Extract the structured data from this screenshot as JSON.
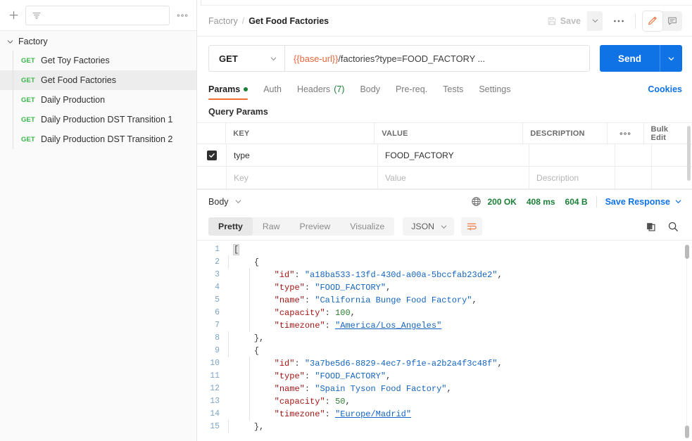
{
  "sidebar": {
    "add_label": "+",
    "filter_placeholder": "",
    "more_label": "000",
    "folder": {
      "name": "Factory",
      "expanded": true
    },
    "requests": [
      {
        "method": "GET",
        "name": "Get Toy Factories",
        "active": false
      },
      {
        "method": "GET",
        "name": "Get Food Factories",
        "active": true
      },
      {
        "method": "GET",
        "name": "Daily Production",
        "active": false
      },
      {
        "method": "GET",
        "name": "Daily Production DST Transition 1",
        "active": false
      },
      {
        "method": "GET",
        "name": "Daily Production DST Transition 2",
        "active": false
      }
    ]
  },
  "header": {
    "breadcrumb_root": "Factory",
    "breadcrumb_sep": "/",
    "breadcrumb_current": "Get Food Factories",
    "save_label": "Save",
    "more_label": "000",
    "edit_icon": "pencil-icon",
    "comment_icon": "comment-icon"
  },
  "request": {
    "method": "GET",
    "url_variable": "{{base-url}}",
    "url_rest": "/factories?type=FOOD_FACTORY ...",
    "send_label": "Send"
  },
  "tabs": {
    "items": [
      {
        "label": "Params",
        "active": true,
        "dot": true
      },
      {
        "label": "Auth",
        "active": false
      },
      {
        "label": "Headers",
        "active": false,
        "count": "(7)"
      },
      {
        "label": "Body",
        "active": false
      },
      {
        "label": "Pre-req.",
        "active": false
      },
      {
        "label": "Tests",
        "active": false
      },
      {
        "label": "Settings",
        "active": false
      }
    ],
    "cookies_label": "Cookies"
  },
  "params": {
    "section_title": "Query Params",
    "columns": [
      "KEY",
      "VALUE",
      "DESCRIPTION"
    ],
    "options_label": "000",
    "bulk_edit_label": "Bulk Edit",
    "rows": [
      {
        "checked": true,
        "key": "type",
        "value": "FOOD_FACTORY",
        "description": ""
      }
    ],
    "placeholder_row": {
      "key": "Key",
      "value": "Value",
      "description": "Description"
    }
  },
  "response": {
    "body_label": "Body",
    "globe_icon": "globe-icon",
    "status": "200 OK",
    "time": "408 ms",
    "size": "604 B",
    "save_response_label": "Save Response",
    "view_tabs": [
      {
        "label": "Pretty",
        "active": true
      },
      {
        "label": "Raw",
        "active": false
      },
      {
        "label": "Preview",
        "active": false
      },
      {
        "label": "Visualize",
        "active": false
      }
    ],
    "format": "JSON",
    "wrap_icon": "word-wrap-icon",
    "copy_icon": "copy-icon",
    "search_icon": "search-icon",
    "code_lines": [
      {
        "n": "1",
        "tokens": [
          {
            "t": "bracket-hl",
            "v": "["
          }
        ]
      },
      {
        "n": "2",
        "tokens": [
          {
            "t": "plain",
            "v": "    "
          },
          {
            "t": "bracket",
            "v": "{"
          }
        ]
      },
      {
        "n": "3",
        "tokens": [
          {
            "t": "plain",
            "v": "        "
          },
          {
            "t": "key",
            "v": "\"id\""
          },
          {
            "t": "punct",
            "v": ": "
          },
          {
            "t": "str",
            "v": "\"a18ba533-13fd-430d-a00a-5bccfab23de2\""
          },
          {
            "t": "punct",
            "v": ","
          }
        ]
      },
      {
        "n": "4",
        "tokens": [
          {
            "t": "plain",
            "v": "        "
          },
          {
            "t": "key",
            "v": "\"type\""
          },
          {
            "t": "punct",
            "v": ": "
          },
          {
            "t": "str",
            "v": "\"FOOD_FACTORY\""
          },
          {
            "t": "punct",
            "v": ","
          }
        ]
      },
      {
        "n": "5",
        "tokens": [
          {
            "t": "plain",
            "v": "        "
          },
          {
            "t": "key",
            "v": "\"name\""
          },
          {
            "t": "punct",
            "v": ": "
          },
          {
            "t": "str",
            "v": "\"California Bunge Food Factory\""
          },
          {
            "t": "punct",
            "v": ","
          }
        ]
      },
      {
        "n": "6",
        "tokens": [
          {
            "t": "plain",
            "v": "        "
          },
          {
            "t": "key",
            "v": "\"capacity\""
          },
          {
            "t": "punct",
            "v": ": "
          },
          {
            "t": "num",
            "v": "100"
          },
          {
            "t": "punct",
            "v": ","
          }
        ]
      },
      {
        "n": "7",
        "tokens": [
          {
            "t": "plain",
            "v": "        "
          },
          {
            "t": "key",
            "v": "\"timezone\""
          },
          {
            "t": "punct",
            "v": ": "
          },
          {
            "t": "str-link",
            "v": "\"America/Los_Angeles\""
          }
        ]
      },
      {
        "n": "8",
        "tokens": [
          {
            "t": "plain",
            "v": "    "
          },
          {
            "t": "bracket",
            "v": "},"
          }
        ]
      },
      {
        "n": "9",
        "tokens": [
          {
            "t": "plain",
            "v": "    "
          },
          {
            "t": "bracket",
            "v": "{"
          }
        ]
      },
      {
        "n": "10",
        "tokens": [
          {
            "t": "plain",
            "v": "        "
          },
          {
            "t": "key",
            "v": "\"id\""
          },
          {
            "t": "punct",
            "v": ": "
          },
          {
            "t": "str",
            "v": "\"3a7be5d6-8829-4ec7-9f1e-a2b2a4f3c48f\""
          },
          {
            "t": "punct",
            "v": ","
          }
        ]
      },
      {
        "n": "11",
        "tokens": [
          {
            "t": "plain",
            "v": "        "
          },
          {
            "t": "key",
            "v": "\"type\""
          },
          {
            "t": "punct",
            "v": ": "
          },
          {
            "t": "str",
            "v": "\"FOOD_FACTORY\""
          },
          {
            "t": "punct",
            "v": ","
          }
        ]
      },
      {
        "n": "12",
        "tokens": [
          {
            "t": "plain",
            "v": "        "
          },
          {
            "t": "key",
            "v": "\"name\""
          },
          {
            "t": "punct",
            "v": ": "
          },
          {
            "t": "str",
            "v": "\"Spain Tyson Food Factory\""
          },
          {
            "t": "punct",
            "v": ","
          }
        ]
      },
      {
        "n": "13",
        "tokens": [
          {
            "t": "plain",
            "v": "        "
          },
          {
            "t": "key",
            "v": "\"capacity\""
          },
          {
            "t": "punct",
            "v": ": "
          },
          {
            "t": "num",
            "v": "50"
          },
          {
            "t": "punct",
            "v": ","
          }
        ]
      },
      {
        "n": "14",
        "tokens": [
          {
            "t": "plain",
            "v": "        "
          },
          {
            "t": "key",
            "v": "\"timezone\""
          },
          {
            "t": "punct",
            "v": ": "
          },
          {
            "t": "str-link",
            "v": "\"Europe/Madrid\""
          }
        ]
      },
      {
        "n": "15",
        "tokens": [
          {
            "t": "plain",
            "v": "    "
          },
          {
            "t": "bracket",
            "v": "},"
          }
        ]
      }
    ]
  },
  "colors": {
    "accent_orange": "#ef6c33",
    "accent_blue": "#0f72e5",
    "method_green": "#3bb54a",
    "status_green": "#1a7f37",
    "json_key": "#a31515",
    "json_string": "#1565c0",
    "json_number": "#2e7d32"
  }
}
